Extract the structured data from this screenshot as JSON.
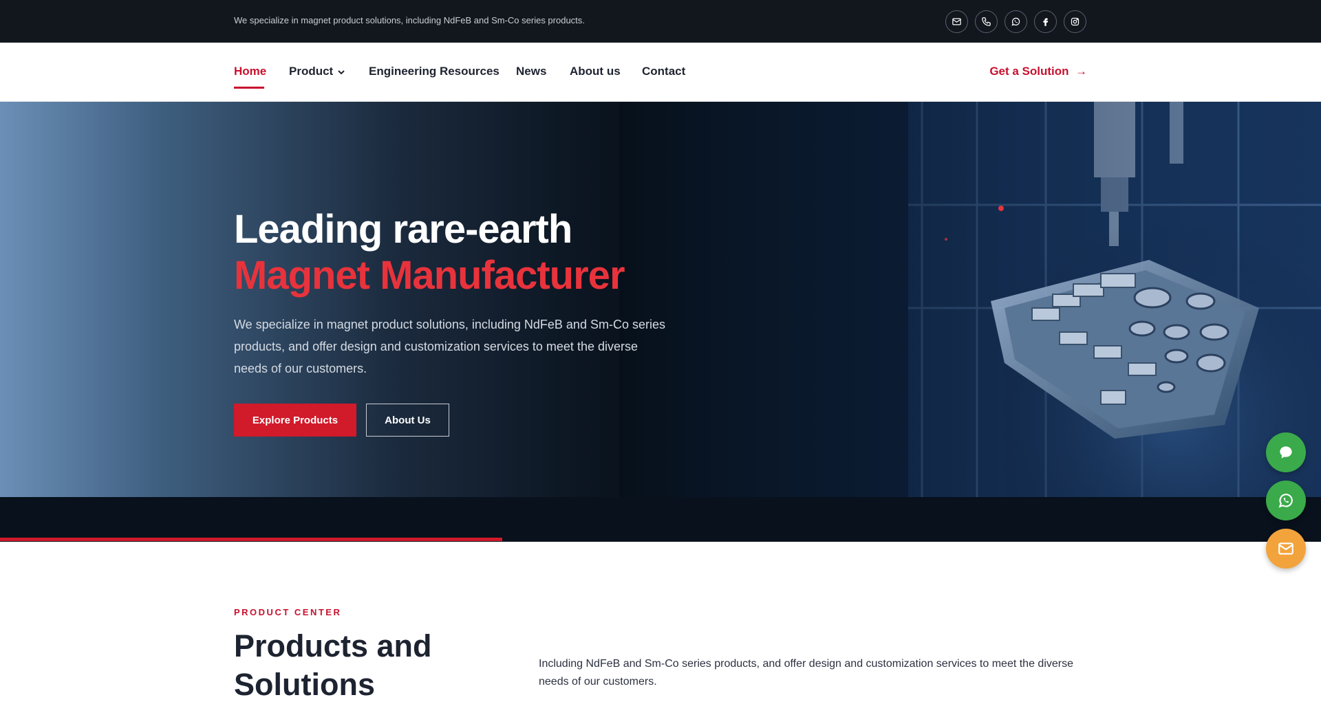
{
  "topbar": {
    "tagline": "We specialize in magnet product solutions, including NdFeB and Sm-Co series products.",
    "social_icons": [
      "mail-icon",
      "phone-icon",
      "whatsapp-icon",
      "facebook-icon",
      "instagram-icon"
    ]
  },
  "nav": {
    "items": [
      {
        "label": "Home",
        "active": true
      },
      {
        "label": "Product",
        "has_dropdown": true
      },
      {
        "label": "Engineering Resources"
      },
      {
        "label": "News"
      },
      {
        "label": "About us"
      },
      {
        "label": "Contact"
      }
    ],
    "cta_label": "Get a Solution",
    "cta_arrow": "→"
  },
  "hero": {
    "title_line1": "Leading rare-earth",
    "title_line2": "Magnet Manufacturer",
    "description": "We specialize in magnet product solutions, including NdFeB and Sm-Co series products, and offer design and customization services to meet the diverse needs of our customers.",
    "primary_button": "Explore Products",
    "secondary_button": "About Us"
  },
  "floating_buttons": [
    "chat-icon",
    "whatsapp-icon",
    "mail-icon"
  ],
  "products_section": {
    "eyebrow": "PRODUCT CENTER",
    "title": "Products and Solutions",
    "description": "Including NdFeB and Sm-Co series products, and offer design and customization services to meet the diverse needs of our customers."
  },
  "colors": {
    "brand_red": "#c8102e",
    "dark_bg": "#12171e",
    "hero_title_red": "#e8333c",
    "fab_green": "#3aaa4a",
    "fab_orange": "#f3a33c"
  }
}
